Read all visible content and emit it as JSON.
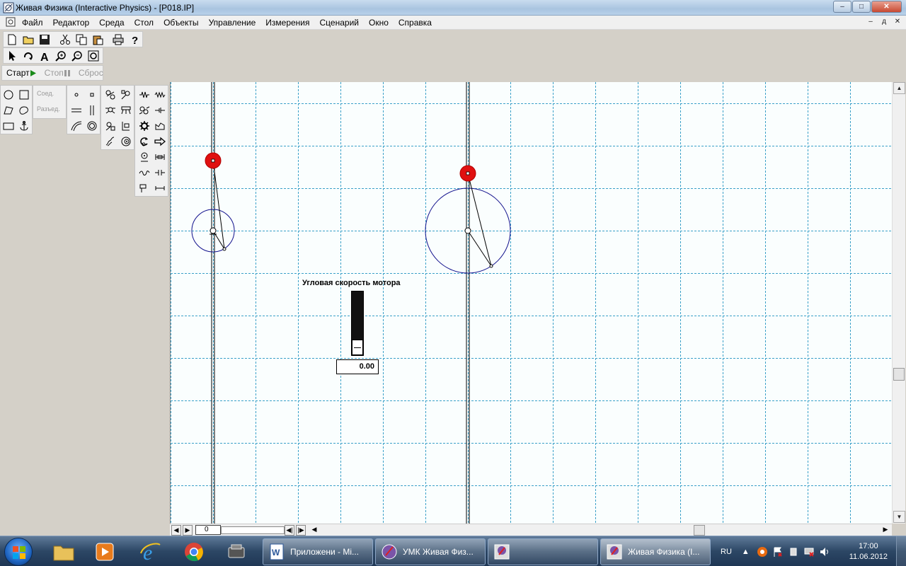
{
  "window": {
    "title": "Живая Физика (Interactive Physics) - [P018.IP]",
    "min_symbol": "–",
    "max_symbol": "□",
    "close_symbol": "✕"
  },
  "menu": {
    "items": [
      "Файл",
      "Редактор",
      "Среда",
      "Стол",
      "Объекты",
      "Управление",
      "Измерения",
      "Сценарий",
      "Окно",
      "Справка"
    ],
    "mdi_min": "–",
    "mdi_restore": "д",
    "mdi_close": "✕"
  },
  "toolbar_icons": [
    "new-file-icon",
    "open-folder-icon",
    "save-disk-icon",
    "cut-scissors-icon",
    "copy-icon",
    "paste-icon",
    "print-icon",
    "help-question-icon"
  ],
  "tool_icons": [
    "arrow-pointer-icon",
    "rotate-icon",
    "text-tool-icon",
    "zoom-in-icon",
    "zoom-out-icon",
    "zoom-fit-icon"
  ],
  "run": {
    "start_label": "Старт",
    "stop_label": "Стоп",
    "reset_label": "Сброс"
  },
  "palette": {
    "join_label": "Соед.",
    "split_label": "Разъед."
  },
  "simulation": {
    "slider_label": "Угловая скорость мотора",
    "slider_value": "0.00",
    "slider_level": 0.0,
    "frame_counter": "0"
  },
  "taskbar": {
    "tasks": [
      {
        "label": "Приложени - Mi..."
      },
      {
        "label": "УМК Живая Физ..."
      },
      {
        "label": ""
      },
      {
        "label": "Живая Физика (I..."
      }
    ],
    "language": "RU",
    "time": "17:00",
    "date": "11.06.2012"
  },
  "colors": {
    "grid": "#3aa0c8",
    "pivot_red": "#e01010",
    "circle_blue": "#10108c",
    "workspace_bg": "#fafefe"
  }
}
